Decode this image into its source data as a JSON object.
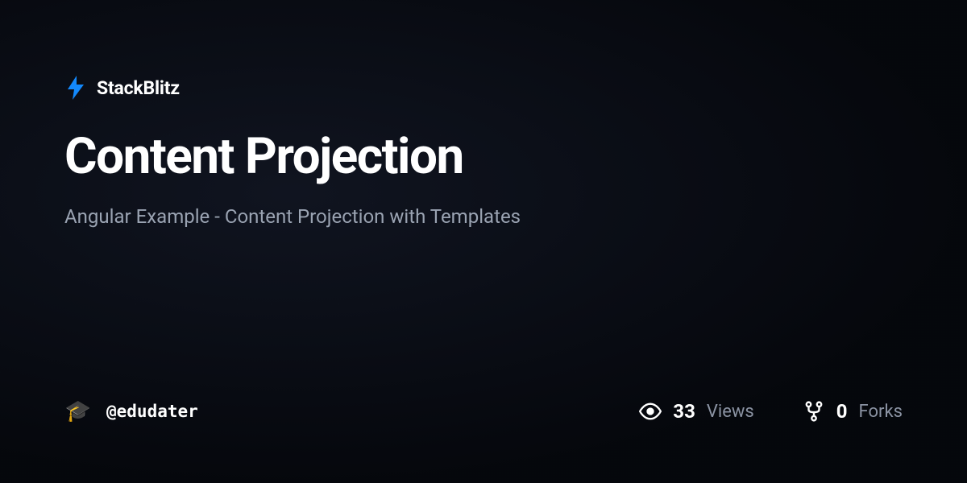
{
  "brand": {
    "name": "StackBlitz",
    "icon": "bolt-icon",
    "accent_color": "#1389fd"
  },
  "project": {
    "title": "Content Projection",
    "description": "Angular Example - Content Projection with Templates"
  },
  "author": {
    "username": "@edudater",
    "avatar_emoji": "🎓"
  },
  "stats": {
    "views": {
      "value": "33",
      "label": "Views"
    },
    "forks": {
      "value": "0",
      "label": "Forks"
    }
  }
}
